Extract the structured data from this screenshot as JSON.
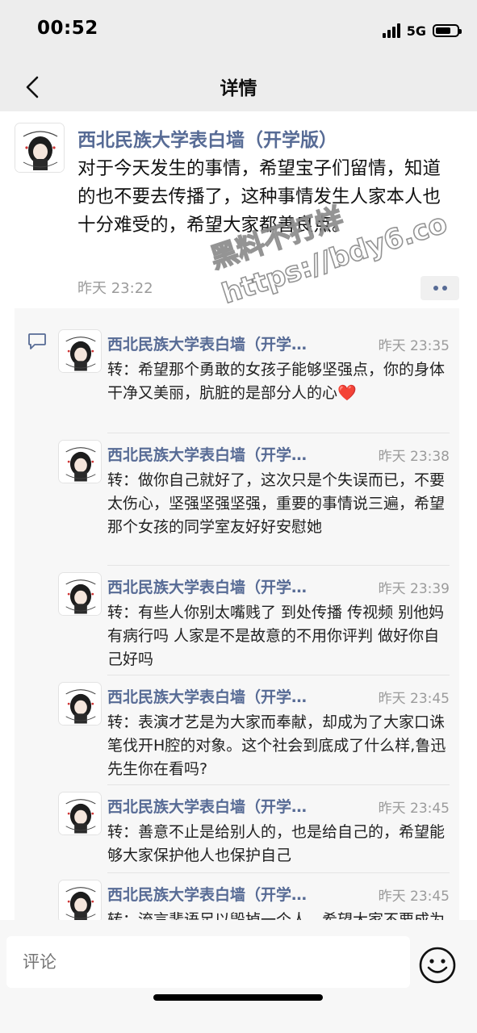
{
  "status": {
    "time": "00:52",
    "network": "5G",
    "battery_level": 0.7
  },
  "nav": {
    "title": "详情",
    "back_icon": "chevron-left-icon"
  },
  "post": {
    "author": "西北民族大学表白墙（开学版）",
    "text": "对于今天发生的事情，希望宝子们留情，知道的也不要去传播了，这种事情发生人家本人也十分难受的，希望大家都善良点。",
    "time": "昨天 23:22",
    "more_icon": "more-dots-icon"
  },
  "watermark": {
    "line1": "黑料不打烊",
    "line2": "https://bdy6.co"
  },
  "comments": [
    {
      "author": "西北民族大学表白墙（开学…",
      "time": "昨天 23:35",
      "text": "转：希望那个勇敢的女孩子能够坚强点，你的身体干净又美丽，肮脏的是部分人的心❤️"
    },
    {
      "author": "西北民族大学表白墙（开学…",
      "time": "昨天 23:38",
      "text": "转：做你自己就好了，这次只是个失误而已，不要太伤心，坚强坚强坚强，重要的事情说三遍，希望那个女孩的同学室友好好安慰她"
    },
    {
      "author": "西北民族大学表白墙（开学…",
      "time": "昨天 23:39",
      "text": "转：有些人你别太嘴贱了 到处传播 传视频 别他妈有病行吗 人家是不是故意的不用你评判 做好你自己好吗"
    },
    {
      "author": "西北民族大学表白墙（开学…",
      "time": "昨天 23:45",
      "text": "转：表演才艺是为大家而奉献，却成为了大家口诛笔伐开H腔的对象。这个社会到底成了什么样,鲁迅先生你在看吗?"
    },
    {
      "author": "西北民族大学表白墙（开学…",
      "time": "昨天 23:45",
      "text": "转：善意不止是给别人的，也是给自己的，希望能够大家保护他人也保护自己"
    },
    {
      "author": "西北民族大学表白墙（开学…",
      "time": "昨天 23:45",
      "text": "转：流言蜚语足以毁掉一个人，希望大家不要成为刽子手，不要用锐利的语言去击"
    }
  ],
  "footer": {
    "comment_placeholder": "评论",
    "emoji_icon": "emoji-smile-icon"
  }
}
